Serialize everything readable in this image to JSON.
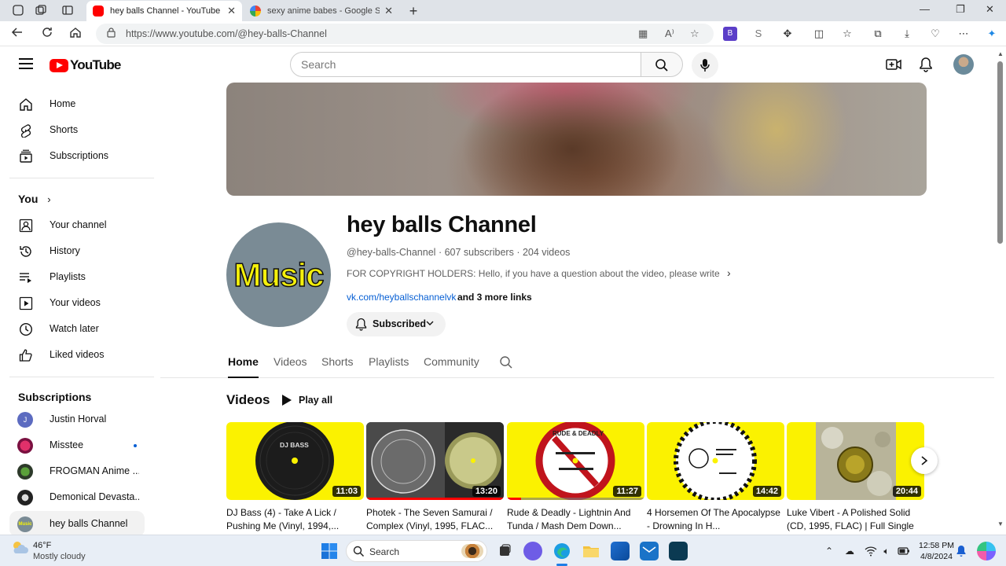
{
  "browser": {
    "tabs": [
      {
        "title": "hey balls Channel - YouTube",
        "active": true
      },
      {
        "title": "sexy anime babes - Google Search",
        "active": false
      }
    ],
    "url": "https://www.youtube.com/@hey-balls-Channel"
  },
  "header": {
    "logo_text": "YouTube",
    "search_placeholder": "Search"
  },
  "sidebar": {
    "main": [
      {
        "label": "Home",
        "icon": "home-icon"
      },
      {
        "label": "Shorts",
        "icon": "shorts-icon"
      },
      {
        "label": "Subscriptions",
        "icon": "subscriptions-icon"
      }
    ],
    "you_heading": "You",
    "you": [
      {
        "label": "Your channel",
        "icon": "your-channel-icon"
      },
      {
        "label": "History",
        "icon": "history-icon"
      },
      {
        "label": "Playlists",
        "icon": "playlists-icon"
      },
      {
        "label": "Your videos",
        "icon": "your-videos-icon"
      },
      {
        "label": "Watch later",
        "icon": "watch-later-icon"
      },
      {
        "label": "Liked videos",
        "icon": "liked-videos-icon"
      }
    ],
    "subs_heading": "Subscriptions",
    "subscriptions": [
      {
        "label": "Justin Horval"
      },
      {
        "label": "Misstee"
      },
      {
        "label": "FROGMAN Anime ..."
      },
      {
        "label": "Demonical Devasta..."
      },
      {
        "label": "hey balls Channel"
      }
    ]
  },
  "channel": {
    "avatar_text": "Music",
    "name": "hey balls Channel",
    "handle": "@hey-balls-Channel",
    "subscribers": "607 subscribers",
    "videos_count": "204 videos",
    "description": "FOR COPYRIGHT HOLDERS: Hello, if you have a question about the video, please write abo...",
    "link": "vk.com/heyballschannelvk",
    "more_links": "and 3 more links",
    "subscribe_label": "Subscribed",
    "tabs": [
      "Home",
      "Videos",
      "Shorts",
      "Playlists",
      "Community"
    ]
  },
  "videos_section": {
    "title": "Videos",
    "play_all": "Play all",
    "items": [
      {
        "title": "DJ Bass (4) - Take A Lick / Pushing Me (Vinyl, 1994,...",
        "duration": "11:03",
        "progress": 0
      },
      {
        "title": "Photek - The Seven Samurai / Complex (Vinyl, 1995, FLAC...",
        "duration": "13:20",
        "progress": 1.0
      },
      {
        "title": "Rude & Deadly - Lightnin And Tunda / Mash Dem Down...",
        "duration": "11:27",
        "progress": 0.1
      },
      {
        "title": "4 Horsemen Of The Apocalypse - Drowning In H...",
        "duration": "14:42",
        "progress": 0
      },
      {
        "title": "Luke Vibert - A Polished Solid (CD, 1995, FLAC) | Full Single",
        "duration": "20:44",
        "progress": 0
      }
    ],
    "thumb_labels": {
      "v1_top": "DJ BASS",
      "v3_top": "RUDE & DEADLY"
    }
  },
  "taskbar": {
    "temperature": "46°F",
    "condition": "Mostly cloudy",
    "search_label": "Search",
    "time": "12:58 PM",
    "date": "4/8/2024"
  }
}
